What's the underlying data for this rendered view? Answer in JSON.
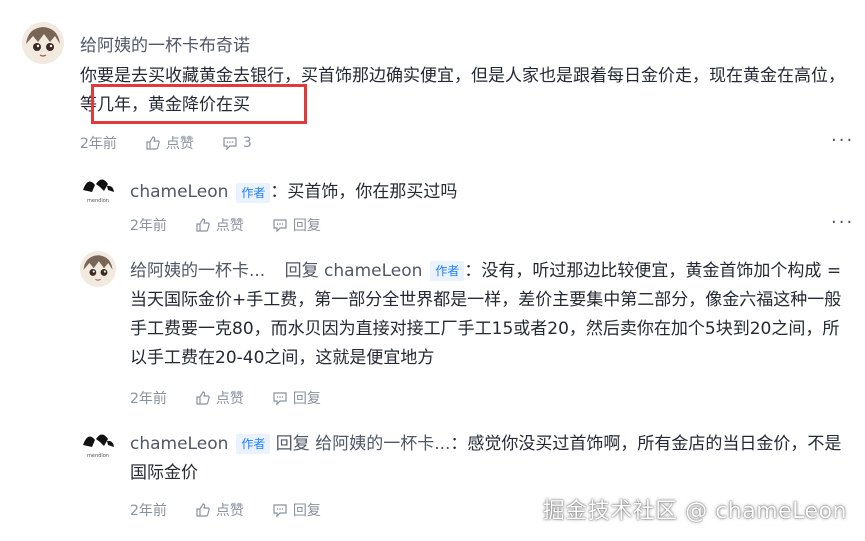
{
  "comment": {
    "author": "给阿姨的一杯卡布奇诺",
    "content": "你要是去买收藏黄金去银行，买首饰那边确实便宜，但是人家也是跟着每日金价走，现在黄金在高位，等几年，黄金降价在买",
    "time": "2年前",
    "like_label": "点赞",
    "reply_count": "3",
    "more": "···"
  },
  "replies": [
    {
      "author": "chameLeon",
      "badge": "作者",
      "content": "：买首饰，你在那买过吗",
      "time": "2年前",
      "like_label": "点赞",
      "reply_label": "回复",
      "more": "···"
    },
    {
      "author": "给阿姨的一杯卡...",
      "reply_prefix": "回复",
      "reply_to": "chameLeon",
      "badge": "作者",
      "content": "：没有，听过那边比较便宜，黄金首饰加个构成 = 当天国际金价+手工费，第一部分全世界都是一样，差价主要集中第二部分，像金六福这种一般手工费要一克80，而水贝因为直接对接工厂手工15或者20，然后卖你在加个5块到20之间，所以手工费在20-40之间，这就是便宜地方",
      "time": "2年前",
      "like_label": "点赞",
      "reply_label": "回复"
    },
    {
      "author": "chameLeon",
      "badge": "作者",
      "reply_prefix": "回复",
      "reply_to": "给阿姨的一杯卡...",
      "content": "：感觉你没买过首饰啊，所有金店的当日金价，不是国际金价",
      "time": "2年前",
      "like_label": "点赞",
      "reply_label": "回复"
    }
  ],
  "watermark": "掘金技术社区 @ chameLeon",
  "colors": {
    "highlight": "#e23a3a",
    "badge": "#1e80ff",
    "meta": "#8a919f"
  }
}
